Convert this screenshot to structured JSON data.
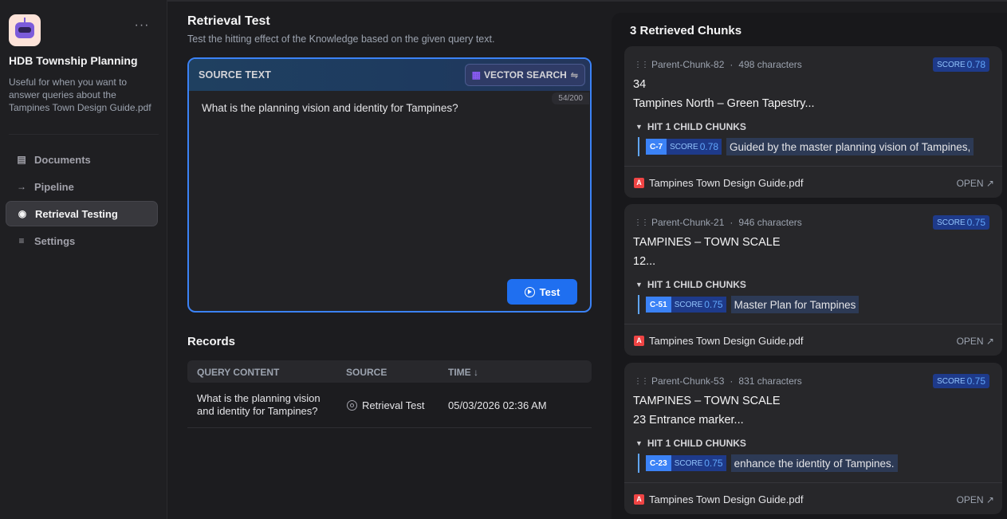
{
  "sidebar": {
    "more_icon": "more-horizontal-icon",
    "kb_title": "HDB Township Planning",
    "kb_description": "Useful for when you want to answer queries about the Tampines Town Design Guide.pdf",
    "nav": [
      {
        "label": "Documents",
        "icon": "document-icon"
      },
      {
        "label": "Pipeline",
        "icon": "pipeline-icon"
      },
      {
        "label": "Retrieval Testing",
        "icon": "target-icon",
        "active": true
      },
      {
        "label": "Settings",
        "icon": "settings-icon"
      }
    ]
  },
  "main": {
    "title": "Retrieval Test",
    "subtitle": "Test the hitting effect of the Knowledge based on the given query text.",
    "query": {
      "header_label": "SOURCE TEXT",
      "search_mode": "VECTOR SEARCH",
      "counter": "54/200",
      "text": "What is the planning vision and identity for Tampines?",
      "test_button": "Test"
    },
    "records": {
      "title": "Records",
      "columns": [
        "QUERY CONTENT",
        "SOURCE",
        "TIME ↓"
      ],
      "rows": [
        {
          "query": "What is the planning vision and identity for Tampines?",
          "source": "Retrieval Test",
          "time": "05/03/2026 02:36 AM"
        }
      ]
    }
  },
  "results": {
    "title": "3 Retrieved Chunks",
    "score_label": "SCORE",
    "hit_label": "HIT 1 CHILD CHUNKS",
    "open_label": "OPEN ↗",
    "chunks": [
      {
        "id": "Parent-Chunk-82",
        "chars": "498 characters",
        "score": "0.78",
        "line1": "34",
        "line2": "Tampines North – Green Tapestry...",
        "child_tag": "C-7",
        "child_score": "0.78",
        "child_text": "Guided by the master planning vision of Tampines,",
        "file": "Tampines Town Design Guide.pdf"
      },
      {
        "id": "Parent-Chunk-21",
        "chars": "946 characters",
        "score": "0.75",
        "line1": "TAMPINES – TOWN SCALE",
        "line2": "12...",
        "child_tag": "C-51",
        "child_score": "0.75",
        "child_text": "Master Plan for Tampines",
        "file": "Tampines Town Design Guide.pdf"
      },
      {
        "id": "Parent-Chunk-53",
        "chars": "831 characters",
        "score": "0.75",
        "line1": "TAMPINES – TOWN SCALE",
        "line2": "23 Entrance marker...",
        "child_tag": "C-23",
        "child_score": "0.75",
        "child_text": "enhance the identity of Tampines.",
        "file": "Tampines Town Design Guide.pdf"
      }
    ]
  }
}
